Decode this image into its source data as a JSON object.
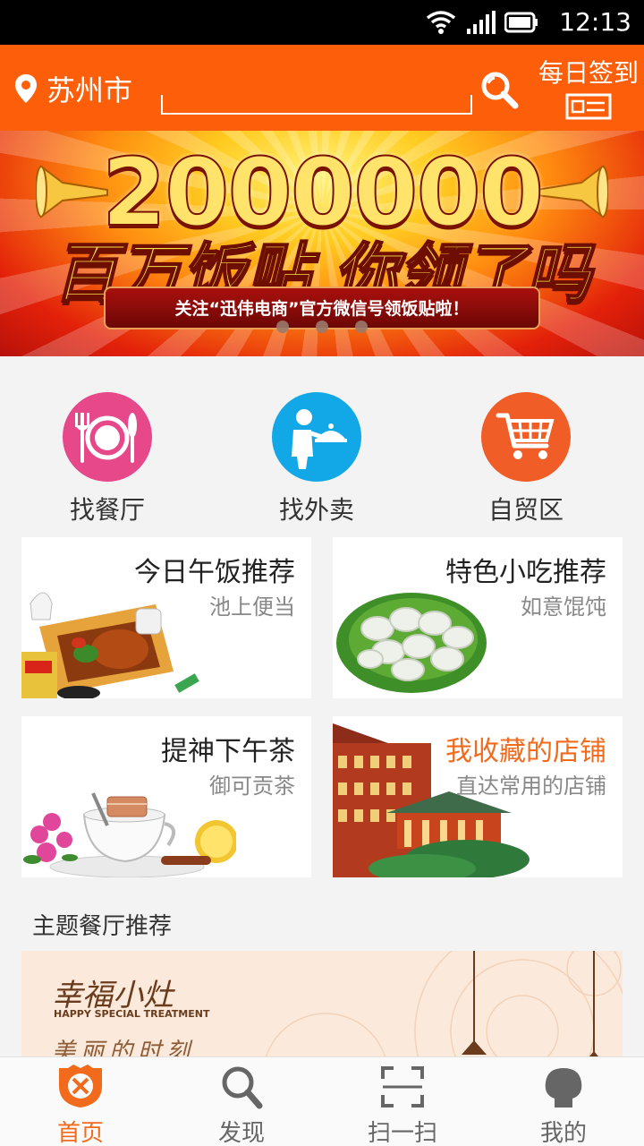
{
  "status_bar": {
    "time": "12:13"
  },
  "header": {
    "city": "苏州市",
    "search_placeholder": "",
    "checkin_label": "每日签到",
    "icons": {
      "location": "location-pin-icon",
      "search": "search-icon",
      "checkin": "card-icon"
    }
  },
  "banner": {
    "big_number": "2000000",
    "headline": "百万饭贴 你领了吗",
    "ribbon_text": "关注“迅伟电商”官方微信号领饭贴啦！",
    "page_count": 3
  },
  "quick_nav": [
    {
      "label": "找餐厅",
      "icon": "plate-cutlery-icon",
      "color": "#e6488a"
    },
    {
      "label": "找外卖",
      "icon": "waiter-icon",
      "color": "#12a7e6"
    },
    {
      "label": "自贸区",
      "icon": "shopping-cart-icon",
      "color": "#f05d26"
    }
  ],
  "cards": [
    {
      "title": "今日午饭推荐",
      "subtitle": "池上便当",
      "title_color": "#222222"
    },
    {
      "title": "特色小吃推荐",
      "subtitle": "如意馄饨",
      "title_color": "#222222"
    },
    {
      "title": "提神下午茶",
      "subtitle": "御可贡茶",
      "title_color": "#222222"
    },
    {
      "title": "我收藏的店铺",
      "subtitle": "直达常用的店铺",
      "title_color": "#f26b1d"
    }
  ],
  "theme_section": {
    "title": "主题餐厅推荐",
    "brand": "幸福小灶",
    "brand_en": "HAPPY SPECIAL TREATMENT",
    "slogan": "美丽的时刻"
  },
  "tab_bar": [
    {
      "label": "首页",
      "icon": "home-emblem-icon",
      "active": true
    },
    {
      "label": "发现",
      "icon": "magnifier-icon",
      "active": false
    },
    {
      "label": "扫一扫",
      "icon": "scan-frame-icon",
      "active": false
    },
    {
      "label": "我的",
      "icon": "profile-head-icon",
      "active": false
    }
  ],
  "colors": {
    "accent": "#fd5e09",
    "active_tab": "#f26b1d"
  }
}
